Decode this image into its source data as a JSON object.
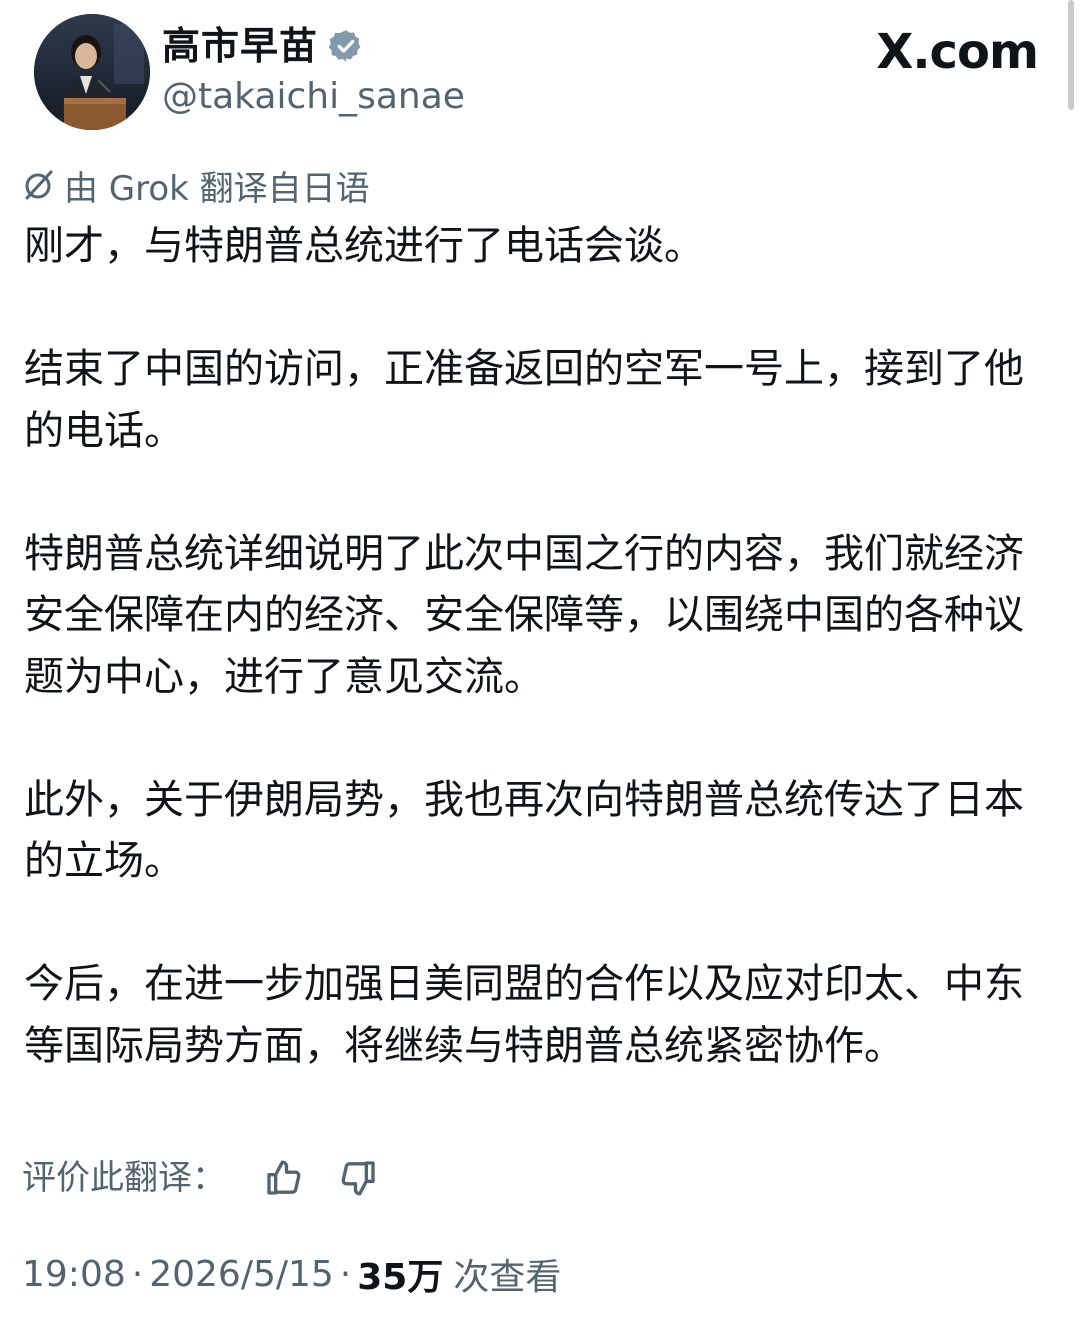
{
  "author": {
    "display_name": "高市早苗",
    "handle": "@takaichi_sanae",
    "verified": true,
    "verified_icon": "verified-badge-icon",
    "avatar_icon": "profile-photo"
  },
  "site": {
    "logo_text": "X.com"
  },
  "translation": {
    "note": "由 Grok 翻译自日语",
    "icon": "grok-icon",
    "rate_label": "评价此翻译：",
    "thumbs_up_icon": "thumbs-up-icon",
    "thumbs_down_icon": "thumbs-down-icon"
  },
  "tweet": {
    "paragraphs": [
      "刚才，与特朗普总统进行了电话会谈。",
      "结束了中国的访问，正准备返回的空军一号上，接到了他的电话。",
      "特朗普总统详细说明了此次中国之行的内容，我们就经济安全保障在内的经济、安全保障等，以围绕中国的各种议题为中心，进行了意见交流。",
      "此外，关于伊朗局势，我也再次向特朗普总统传达了日本的立场。",
      "今后，在进一步加强日美同盟的合作以及应对印太、中东等国际局势方面，将继续与特朗普总统紧密协作。"
    ]
  },
  "meta": {
    "time": "19:08",
    "separator": "·",
    "date": "2026/5/15",
    "views_count": "35万",
    "views_label": "次查看"
  },
  "colors": {
    "text_primary": "#0f1419",
    "text_secondary": "#536471",
    "background": "#ffffff"
  }
}
